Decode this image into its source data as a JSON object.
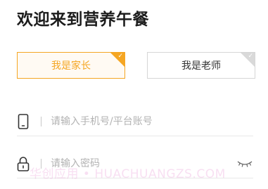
{
  "page": {
    "title": "欢迎来到营养午餐"
  },
  "roles": {
    "parent_label": "我是家长",
    "teacher_label": "我是老师",
    "selected": "parent"
  },
  "form": {
    "phone_placeholder": "请输入手机号/平台账号",
    "password_placeholder": "请输入密码"
  },
  "icons": {
    "phone": "phone-icon",
    "lock": "lock-icon",
    "eye": "eye-closed-icon",
    "check": "check-icon"
  },
  "watermark": {
    "text": "华创应用 • HUACHUANGZS.COM"
  },
  "colors": {
    "accent": "#f5a623",
    "inactive_border": "#d6d6d6",
    "placeholder": "#b3b3b3"
  }
}
